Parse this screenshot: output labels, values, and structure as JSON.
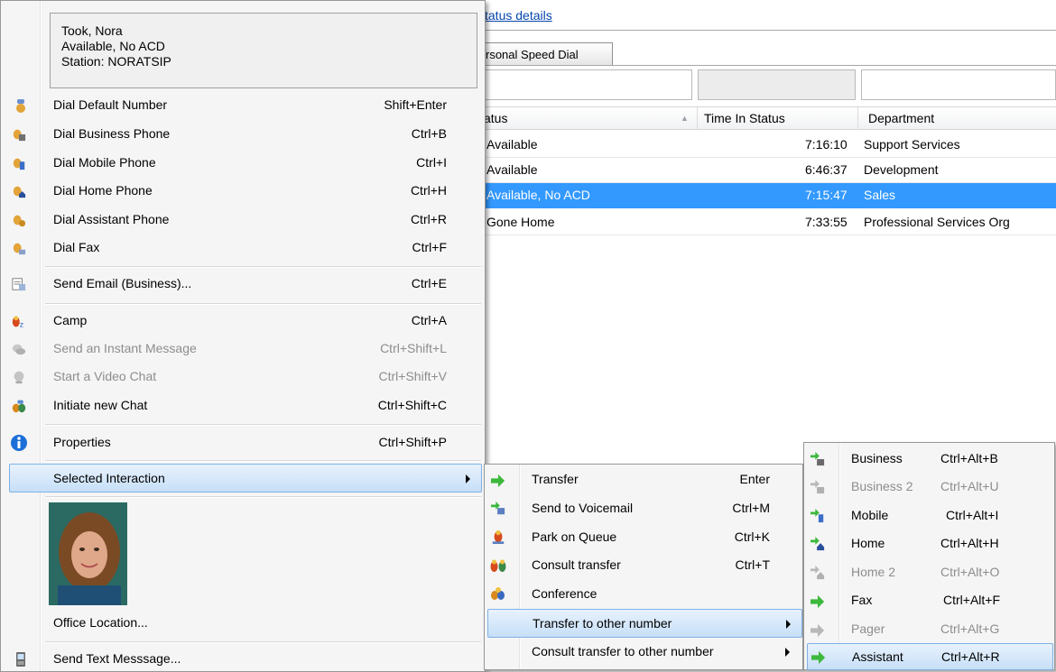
{
  "background": {
    "status_link": "tatus details",
    "tab_label": "rsonal Speed Dial",
    "columns": [
      "atus",
      "Time In Status",
      "Department"
    ],
    "rows": [
      {
        "status": "Available",
        "time": "7:16:10",
        "department": "Support Services"
      },
      {
        "status": "Available",
        "time": "6:46:37",
        "department": "Development"
      },
      {
        "status": "Available, No ACD",
        "time": "7:15:47",
        "department": "Sales"
      },
      {
        "status": "Gone Home",
        "time": "7:33:55",
        "department": "Professional Services Org"
      }
    ],
    "selected_row_color": "#3399ff"
  },
  "main_menu": {
    "header": {
      "name": "Took, Nora",
      "status": "Available, No ACD",
      "station": "Station: NORATSIP"
    },
    "items": [
      {
        "label": "Dial Default Number",
        "shortcut": "Shift+Enter",
        "icon": "dial-default-icon"
      },
      {
        "label": "Dial Business Phone",
        "shortcut": "Ctrl+B",
        "icon": "dial-business-icon"
      },
      {
        "label": "Dial Mobile Phone",
        "shortcut": "Ctrl+I",
        "icon": "dial-mobile-icon"
      },
      {
        "label": "Dial Home Phone",
        "shortcut": "Ctrl+H",
        "icon": "dial-home-icon"
      },
      {
        "label": "Dial Assistant Phone",
        "shortcut": "Ctrl+R",
        "icon": "dial-assistant-icon"
      },
      {
        "label": "Dial Fax",
        "shortcut": "Ctrl+F",
        "icon": "dial-fax-icon"
      },
      {
        "label": "Send Email (Business)...",
        "shortcut": "Ctrl+E",
        "icon": "email-icon"
      },
      {
        "label": "Camp",
        "shortcut": "Ctrl+A",
        "icon": "camp-icon"
      },
      {
        "label": "Send an Instant Message",
        "shortcut": "Ctrl+Shift+L",
        "icon": "instant-message-icon",
        "disabled": true
      },
      {
        "label": "Start a Video Chat",
        "shortcut": "Ctrl+Shift+V",
        "icon": "video-chat-icon",
        "disabled": true
      },
      {
        "label": "Initiate new Chat",
        "shortcut": "Ctrl+Shift+C",
        "icon": "new-chat-icon"
      },
      {
        "label": "Properties",
        "shortcut": "Ctrl+Shift+P",
        "icon": "info-icon"
      },
      {
        "label": "Selected Interaction",
        "shortcut": "",
        "submenu": true
      },
      {
        "label": "Office Location...",
        "shortcut": ""
      },
      {
        "label": "Send Text Messsage...",
        "shortcut": "",
        "icon": "text-message-icon"
      }
    ]
  },
  "interaction_menu": {
    "items": [
      {
        "label": "Transfer",
        "shortcut": "Enter",
        "icon": "transfer-arrow-icon"
      },
      {
        "label": "Send to Voicemail",
        "shortcut": "Ctrl+M",
        "icon": "voicemail-icon"
      },
      {
        "label": "Park on Queue",
        "shortcut": "Ctrl+K",
        "icon": "park-icon"
      },
      {
        "label": "Consult transfer",
        "shortcut": "Ctrl+T",
        "icon": "consult-icon"
      },
      {
        "label": "Conference",
        "shortcut": "",
        "icon": "conference-icon"
      },
      {
        "label": "Transfer to other number",
        "shortcut": "",
        "submenu": true
      },
      {
        "label": "Consult transfer to other number",
        "shortcut": "",
        "submenu": true
      }
    ]
  },
  "transfer_menu": {
    "items": [
      {
        "label": "Business",
        "shortcut": "Ctrl+Alt+B",
        "icon": "transfer-business-icon"
      },
      {
        "label": "Business 2",
        "shortcut": "Ctrl+Alt+U",
        "icon": "transfer-business2-icon",
        "disabled": true
      },
      {
        "label": "Mobile",
        "shortcut": "Ctrl+Alt+I",
        "icon": "transfer-mobile-icon"
      },
      {
        "label": "Home",
        "shortcut": "Ctrl+Alt+H",
        "icon": "transfer-home-icon"
      },
      {
        "label": "Home 2",
        "shortcut": "Ctrl+Alt+O",
        "icon": "transfer-home2-icon",
        "disabled": true
      },
      {
        "label": "Fax",
        "shortcut": "Ctrl+Alt+F",
        "icon": "transfer-fax-icon"
      },
      {
        "label": "Pager",
        "shortcut": "Ctrl+Alt+G",
        "icon": "transfer-pager-icon",
        "disabled": true
      },
      {
        "label": "Assistant",
        "shortcut": "Ctrl+Alt+R",
        "icon": "transfer-assistant-icon"
      }
    ]
  },
  "colors": {
    "highlight_border": "#7fb0e6",
    "transfer_green": "#3cb83c",
    "info_blue": "#1d6fd8"
  }
}
